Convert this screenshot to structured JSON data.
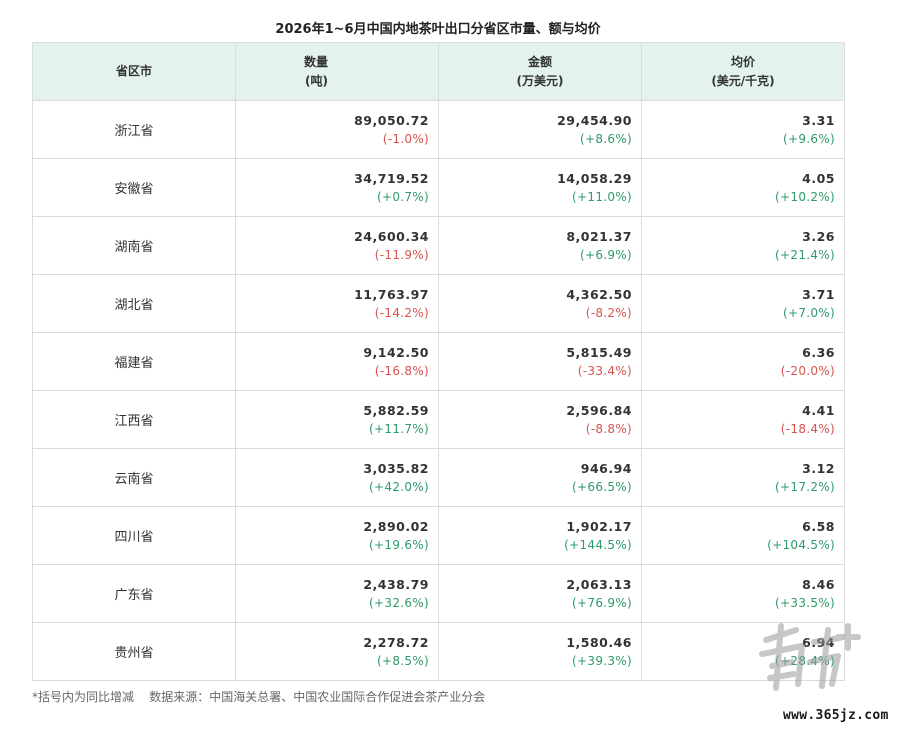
{
  "title": "2026年1~6月中国内地茶叶出口分省区市量、额与均价",
  "headers": {
    "province": "省区市",
    "qty": "数量",
    "qty_unit": "(吨)",
    "amount": "金额",
    "amount_unit": "(万美元)",
    "price": "均价",
    "price_unit": "(美元/千克)"
  },
  "rows": [
    {
      "province": "浙江省",
      "qty": "89,050.72",
      "qty_chg": "(-1.0%)",
      "amount": "29,454.90",
      "amount_chg": "(+8.6%)",
      "price": "3.31",
      "price_chg": "(+9.6%)"
    },
    {
      "province": "安徽省",
      "qty": "34,719.52",
      "qty_chg": "(+0.7%)",
      "amount": "14,058.29",
      "amount_chg": "(+11.0%)",
      "price": "4.05",
      "price_chg": "(+10.2%)"
    },
    {
      "province": "湖南省",
      "qty": "24,600.34",
      "qty_chg": "(-11.9%)",
      "amount": "8,021.37",
      "amount_chg": "(+6.9%)",
      "price": "3.26",
      "price_chg": "(+21.4%)"
    },
    {
      "province": "湖北省",
      "qty": "11,763.97",
      "qty_chg": "(-14.2%)",
      "amount": "4,362.50",
      "amount_chg": "(-8.2%)",
      "price": "3.71",
      "price_chg": "(+7.0%)"
    },
    {
      "province": "福建省",
      "qty": "9,142.50",
      "qty_chg": "(-16.8%)",
      "amount": "5,815.49",
      "amount_chg": "(-33.4%)",
      "price": "6.36",
      "price_chg": "(-20.0%)"
    },
    {
      "province": "江西省",
      "qty": "5,882.59",
      "qty_chg": "(+11.7%)",
      "amount": "2,596.84",
      "amount_chg": "(-8.8%)",
      "price": "4.41",
      "price_chg": "(-18.4%)"
    },
    {
      "province": "云南省",
      "qty": "3,035.82",
      "qty_chg": "(+42.0%)",
      "amount": "946.94",
      "amount_chg": "(+66.5%)",
      "price": "3.12",
      "price_chg": "(+17.2%)"
    },
    {
      "province": "四川省",
      "qty": "2,890.02",
      "qty_chg": "(+19.6%)",
      "amount": "1,902.17",
      "amount_chg": "(+144.5%)",
      "price": "6.58",
      "price_chg": "(+104.5%)"
    },
    {
      "province": "广东省",
      "qty": "2,438.79",
      "qty_chg": "(+32.6%)",
      "amount": "2,063.13",
      "amount_chg": "(+76.9%)",
      "price": "8.46",
      "price_chg": "(+33.5%)"
    },
    {
      "province": "贵州省",
      "qty": "2,278.72",
      "qty_chg": "(+8.5%)",
      "amount": "1,580.46",
      "amount_chg": "(+39.3%)",
      "price": "6.94",
      "price_chg": "(+28.4%)"
    }
  ],
  "footnote": "*括号内为同比增减    数据来源：中国海关总署、中国农业国际合作促进会茶产业分会",
  "watermark": {
    "logo_text": "南方+",
    "url": "www.365jz.com"
  },
  "colors": {
    "header_bg": "#e3f2ef",
    "negative": "#d9534f",
    "positive": "#2f9a6a"
  }
}
